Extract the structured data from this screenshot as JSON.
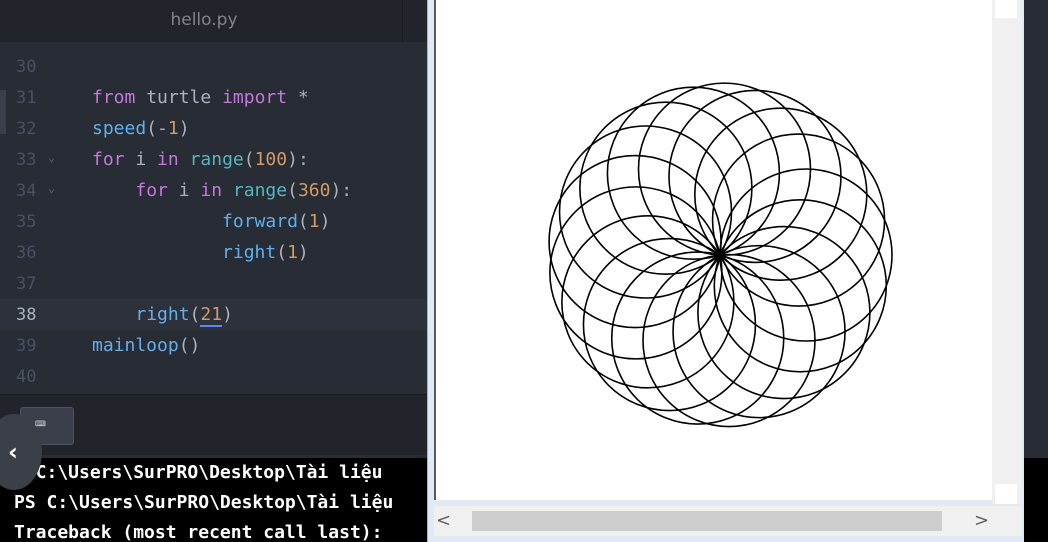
{
  "editor": {
    "tab_title": "hello.py",
    "peek_text": ")",
    "lines": [
      {
        "n": "30",
        "tokens": []
      },
      {
        "n": "31",
        "tokens": [
          [
            "kw",
            "from"
          ],
          [
            "plain",
            " turtle "
          ],
          [
            "kw",
            "import"
          ],
          [
            "plain",
            " *"
          ]
        ]
      },
      {
        "n": "32",
        "tokens": [
          [
            "fn",
            "speed"
          ],
          [
            "plain",
            "(-"
          ],
          [
            "num",
            "1"
          ],
          [
            "plain",
            ")"
          ]
        ]
      },
      {
        "n": "33",
        "fold": true,
        "tokens": [
          [
            "kw",
            "for"
          ],
          [
            "plain",
            " i "
          ],
          [
            "kw",
            "in"
          ],
          [
            "plain",
            " "
          ],
          [
            "bi",
            "range"
          ],
          [
            "plain",
            "("
          ],
          [
            "num",
            "100"
          ],
          [
            "plain",
            "):"
          ]
        ]
      },
      {
        "n": "34",
        "fold": true,
        "tokens": [
          [
            "plain",
            "    "
          ],
          [
            "kw",
            "for"
          ],
          [
            "plain",
            " i "
          ],
          [
            "kw",
            "in"
          ],
          [
            "plain",
            " "
          ],
          [
            "bi",
            "range"
          ],
          [
            "plain",
            "("
          ],
          [
            "num",
            "360"
          ],
          [
            "plain",
            "):"
          ]
        ]
      },
      {
        "n": "35",
        "tokens": [
          [
            "plain",
            "            "
          ],
          [
            "fn",
            "forward"
          ],
          [
            "plain",
            "("
          ],
          [
            "num",
            "1"
          ],
          [
            "plain",
            ")"
          ]
        ]
      },
      {
        "n": "36",
        "tokens": [
          [
            "plain",
            "            "
          ],
          [
            "fn",
            "right"
          ],
          [
            "plain",
            "("
          ],
          [
            "num",
            "1"
          ],
          [
            "plain",
            ")"
          ]
        ]
      },
      {
        "n": "37",
        "tokens": []
      },
      {
        "n": "38",
        "current": true,
        "tokens": [
          [
            "plain",
            "    "
          ],
          [
            "fn",
            "right"
          ],
          [
            "plain",
            "("
          ],
          [
            "num",
            "21"
          ],
          [
            "plain",
            ")"
          ]
        ]
      },
      {
        "n": "39",
        "tokens": [
          [
            "fn",
            "mainloop"
          ],
          [
            "plain",
            "()"
          ]
        ]
      },
      {
        "n": "40",
        "tokens": []
      }
    ]
  },
  "panel": {
    "keyboard_icon": "keyboard-icon",
    "keyboard_glyph": "⌨",
    "back_glyph": "‹"
  },
  "terminal": {
    "lines": [
      "  C:\\Users\\SurPRO\\Desktop\\Tài liệu",
      "PS C:\\Users\\SurPRO\\Desktop\\Tài liệu",
      "Traceback (most recent call last):"
    ],
    "partial_first_char": "S"
  },
  "turtle_window": {
    "scroll_left_glyph": "<",
    "scroll_right_glyph": ">",
    "drawing": {
      "circles": 17,
      "turn_degrees": 21,
      "stroke": "#000000"
    }
  },
  "colors": {
    "editor_bg": "#282c34",
    "keyword": "#c678dd",
    "function": "#61afef",
    "builtin": "#56b6c2",
    "number": "#d19a66"
  }
}
